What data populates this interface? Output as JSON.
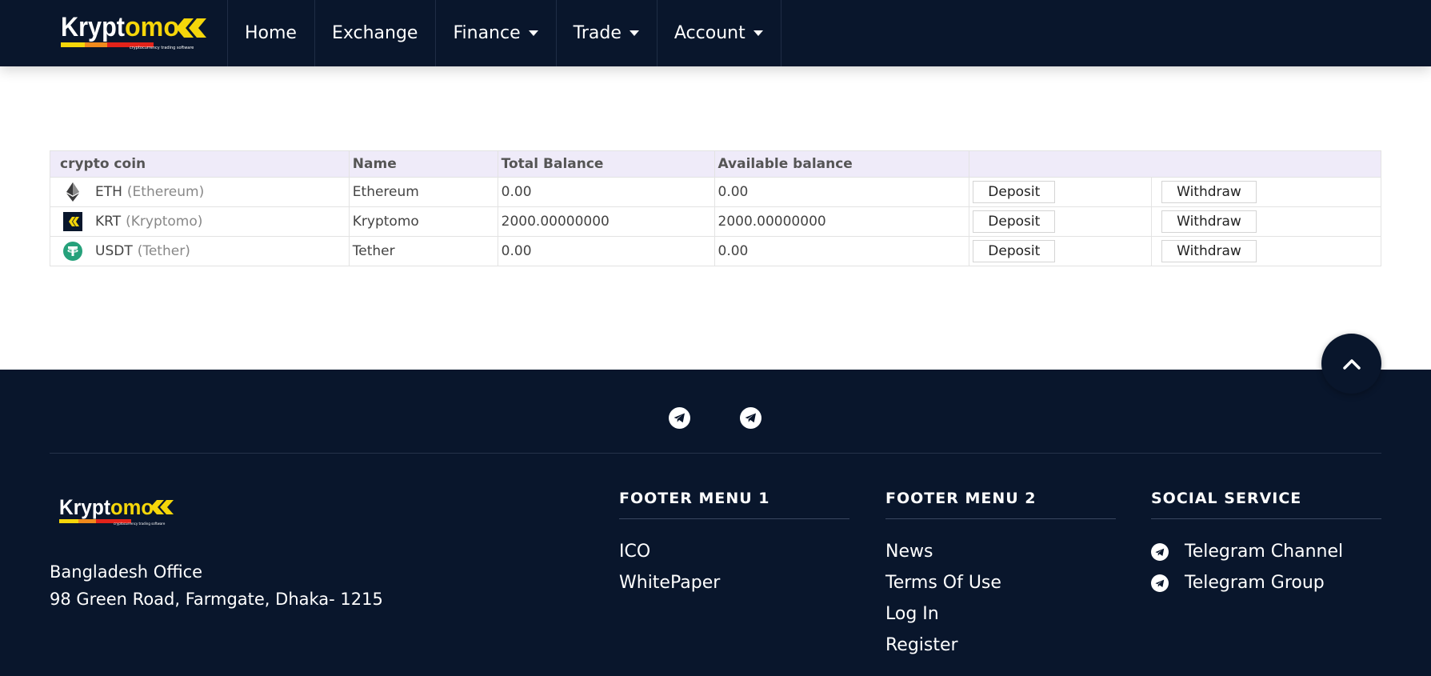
{
  "brand": {
    "name_part1": "Krypt",
    "name_part2": "omo",
    "tagline": "cryptocurrency trading software",
    "colors": {
      "white": "#ffffff",
      "yellow": "#f5d60a",
      "red": "#e2231a",
      "orange": "#f08a1c"
    }
  },
  "nav": {
    "items": [
      {
        "label": "Home",
        "dropdown": false
      },
      {
        "label": "Exchange",
        "dropdown": false
      },
      {
        "label": "Finance",
        "dropdown": true
      },
      {
        "label": "Trade",
        "dropdown": true
      },
      {
        "label": "Account",
        "dropdown": true
      }
    ]
  },
  "table": {
    "headers": [
      "crypto coin",
      "Name",
      "Total Balance",
      "Available balance",
      ""
    ],
    "rows": [
      {
        "icon": "ethereum-icon",
        "symbol": "ETH",
        "full": "(Ethereum)",
        "name": "Ethereum",
        "total": "0.00",
        "available": "0.00",
        "deposit": "Deposit",
        "withdraw": "Withdraw"
      },
      {
        "icon": "kryptomo-icon",
        "symbol": "KRT",
        "full": "(Kryptomo)",
        "name": "Kryptomo",
        "total": "2000.00000000",
        "available": "2000.00000000",
        "deposit": "Deposit",
        "withdraw": "Withdraw"
      },
      {
        "icon": "tether-icon",
        "symbol": "USDT",
        "full": "(Tether)",
        "name": "Tether",
        "total": "0.00",
        "available": "0.00",
        "deposit": "Deposit",
        "withdraw": "Withdraw"
      }
    ]
  },
  "scroll_top": {
    "icon": "chevron-up-icon"
  },
  "footer": {
    "social_icons": [
      "telegram-icon",
      "telegram-icon"
    ],
    "address_line1": "Bangladesh Office",
    "address_line2": "98 Green Road, Farmgate, Dhaka- 1215",
    "menu1": {
      "title": "FOOTER MENU 1",
      "links": [
        "ICO",
        "WhitePaper"
      ]
    },
    "menu2": {
      "title": "FOOTER MENU 2",
      "links": [
        "News",
        "Terms Of Use",
        "Log In",
        "Register"
      ]
    },
    "social": {
      "title": "SOCIAL SERVICE",
      "links": [
        "Telegram Channel",
        "Telegram Group"
      ]
    }
  },
  "colors": {
    "navbar_bg": "#09162c",
    "footer_bg": "#09162c",
    "table_header_bg": "#efebf9",
    "eth": "#3c3c3d",
    "usdt": "#26a17b"
  }
}
